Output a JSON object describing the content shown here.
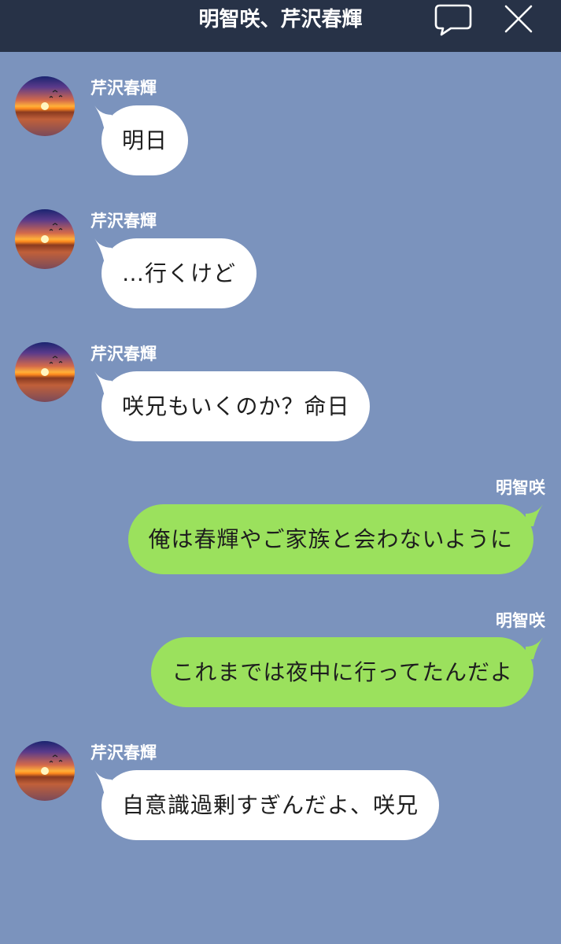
{
  "header": {
    "title": "明智咲、芹沢春輝",
    "chat_icon": "speech-bubble-icon",
    "close_icon": "close-icon"
  },
  "messages": [
    {
      "sender": "芹沢春輝",
      "side": "left",
      "text": "明日"
    },
    {
      "sender": "芹沢春輝",
      "side": "left",
      "text": "…行くけど"
    },
    {
      "sender": "芹沢春輝",
      "side": "left",
      "text": "咲兄もいくのか？命日"
    },
    {
      "sender": "明智咲",
      "side": "right",
      "text": "俺は春輝やご家族と会わないように"
    },
    {
      "sender": "明智咲",
      "side": "right",
      "text": "これまでは夜中に行ってたんだよ"
    },
    {
      "sender": "芹沢春輝",
      "side": "left",
      "text": "自意識過剰すぎんだよ、咲兄"
    }
  ],
  "colors": {
    "header_bg": "#273247",
    "chat_bg": "#7b93bd",
    "incoming_bubble": "#ffffff",
    "outgoing_bubble": "#9be15d"
  }
}
